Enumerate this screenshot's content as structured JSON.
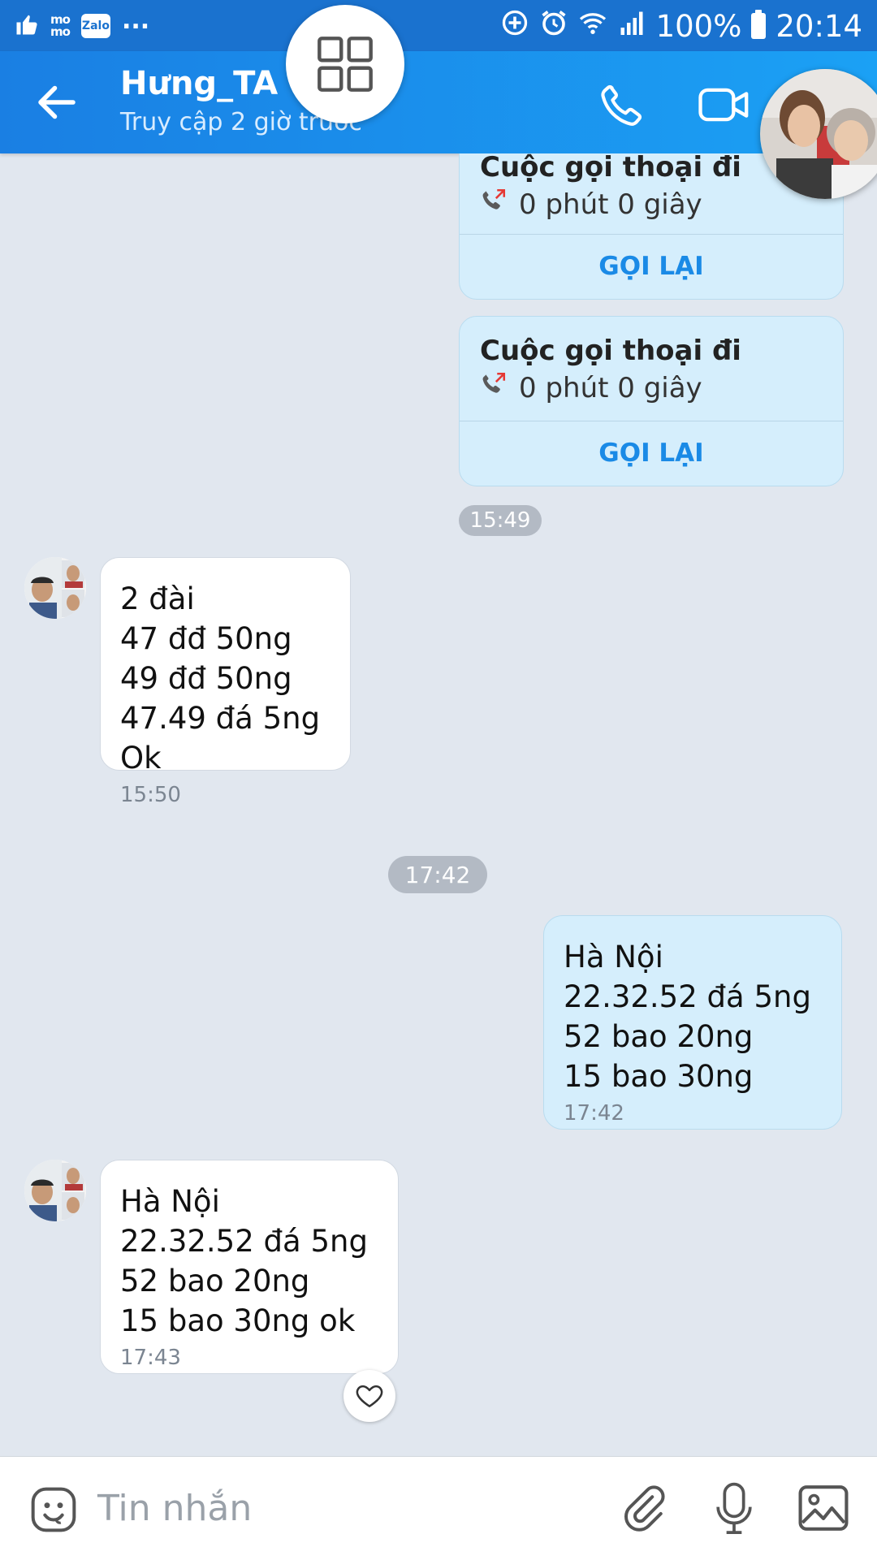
{
  "status_bar": {
    "momo_top": "mo",
    "momo_bottom": "mo",
    "zalo_label": "Zalo",
    "more": "...",
    "battery": "100%",
    "time": "20:14"
  },
  "header": {
    "contact_name": "Hưng_TA",
    "last_seen": "Truy cập 2 giờ trước"
  },
  "calls": [
    {
      "title": "Cuộc gọi thoại đi",
      "duration": "0 phút 0 giây",
      "action": "GỌI LẠI"
    },
    {
      "title": "Cuộc gọi thoại đi",
      "duration": "0 phút 0 giây",
      "action": "GỌI LẠI"
    }
  ],
  "separators": [
    "15:49",
    "17:42"
  ],
  "messages": [
    {
      "from": "contact",
      "lines": [
        "2 đài",
        "47 đđ 50ng",
        "49 đđ 50ng",
        "47.49 đá 5ng",
        "Ok"
      ],
      "time": "15:50"
    },
    {
      "from": "me",
      "lines": [
        "Hà Nội",
        "22.32.52 đá 5ng",
        "52 bao 20ng",
        "15 bao 30ng"
      ],
      "time": "17:42"
    },
    {
      "from": "contact",
      "lines": [
        "Hà Nội",
        "22.32.52 đá 5ng",
        "52 bao 20ng",
        "15 bao 30ng ok"
      ],
      "time": "17:43"
    }
  ],
  "composer": {
    "placeholder": "Tin nhắn"
  },
  "icons": {
    "back": "arrow-left-icon",
    "call": "phone-icon",
    "video": "video-camera-icon",
    "grid": "grid-icon",
    "heart": "heart-icon",
    "emoji": "emoji-icon",
    "attach": "paperclip-icon",
    "mic": "microphone-icon",
    "image": "image-icon"
  },
  "colors": {
    "header": "#1a7fe3",
    "status_bar": "#1a72cf",
    "chat_bg": "#e1e7ef",
    "my_bubble": "#d5eefc",
    "call_again": "#1a8ae6"
  }
}
